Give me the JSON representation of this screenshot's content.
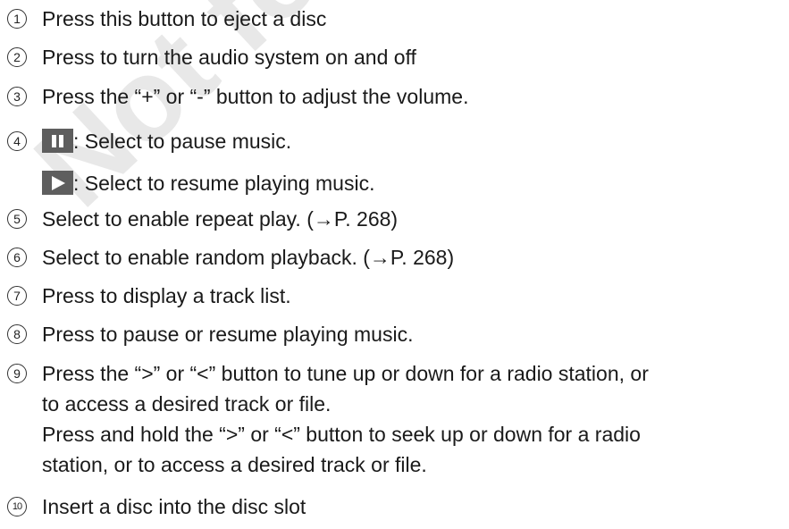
{
  "watermark": "Not for Reprint",
  "items": [
    {
      "num": "1",
      "lines": [
        "Press this button to eject a disc"
      ]
    },
    {
      "num": "2",
      "lines": [
        "Press to turn the audio system on and off"
      ]
    },
    {
      "num": "3",
      "lines": [
        "Press the “+” or “-” button to adjust the volume."
      ]
    },
    {
      "num": "4",
      "pause_text": ": Select to pause music.",
      "play_text": ": Select to resume playing music.",
      "icons": [
        "pause-icon",
        "play-icon"
      ]
    },
    {
      "num": "5",
      "lines": [
        "Select to enable repeat play. (→P. 268)"
      ]
    },
    {
      "num": "6",
      "lines": [
        "Select to enable random playback. (→P. 268)"
      ]
    },
    {
      "num": "7",
      "lines": [
        "Press to display a track list."
      ]
    },
    {
      "num": "8",
      "lines": [
        "Press to pause or resume playing music."
      ]
    },
    {
      "num": "9",
      "lines": [
        "Press the “>” or “<” button to tune up or down for a radio station, or",
        "to access a desired track or file.",
        "Press and hold the “>” or “<” button to seek up or down for a radio",
        "station, or to access a desired track or file."
      ]
    },
    {
      "num": "10",
      "lines": [
        "Insert a disc into the disc slot"
      ]
    }
  ]
}
